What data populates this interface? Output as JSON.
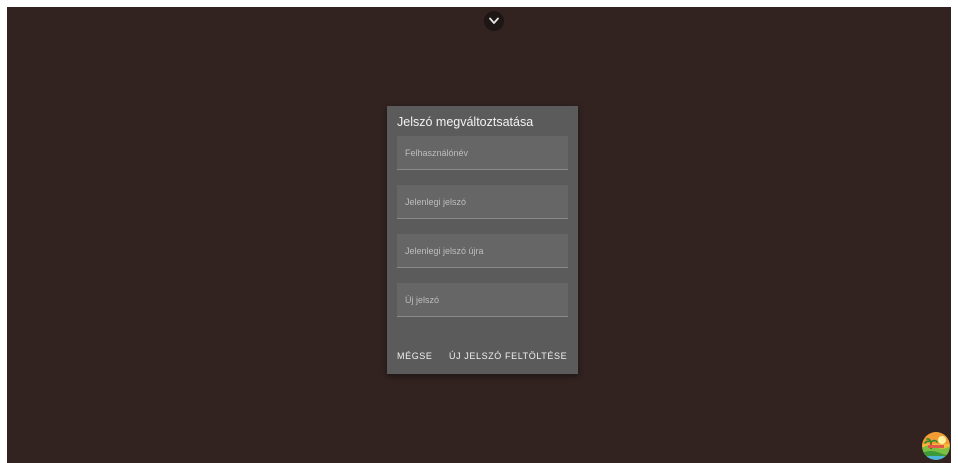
{
  "dialog": {
    "title": "Jelszó megváltoztsatása",
    "fields": [
      {
        "placeholder": "Felhasználónév",
        "value": ""
      },
      {
        "placeholder": "Jelenlegi jelszó",
        "value": ""
      },
      {
        "placeholder": "Jelenlegi jelszó újra",
        "value": ""
      },
      {
        "placeholder": "Új jelszó",
        "value": ""
      }
    ],
    "cancel_label": "MÉGSE",
    "submit_label": "ÚJ JELSZÓ FELTÖLTÉSE"
  },
  "colors": {
    "background": "#322321",
    "dialog": "#5b5b5b",
    "field": "#666666",
    "toggle": "#1e1614"
  },
  "icons": {
    "top_toggle": "chevron-down-icon",
    "corner_logo": "landscape-logo-icon"
  }
}
